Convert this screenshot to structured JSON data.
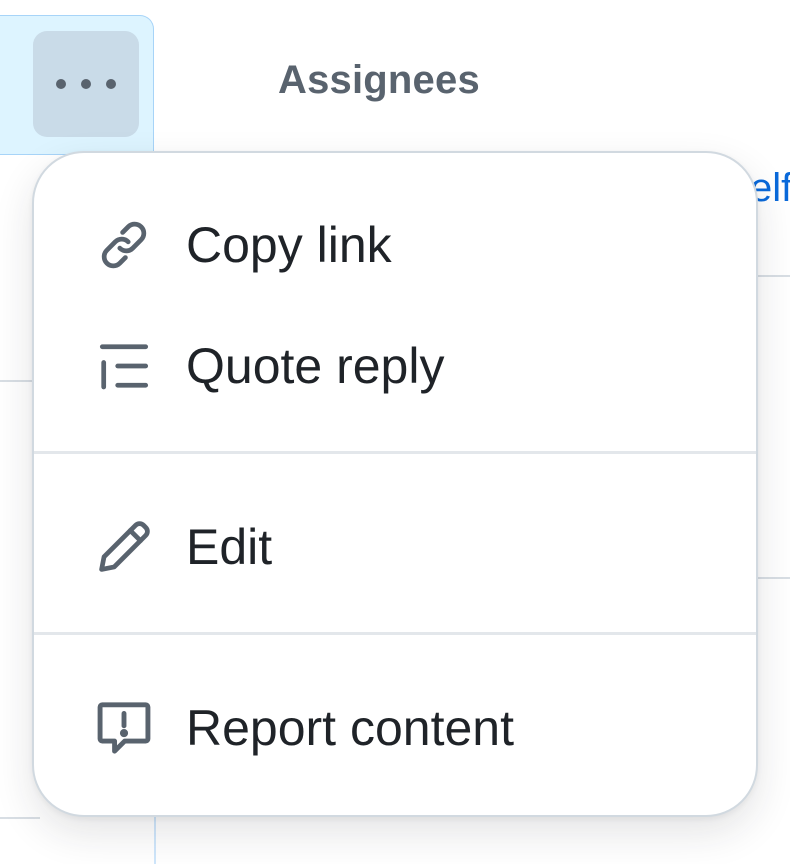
{
  "comment": {
    "more_button_label": "More options"
  },
  "sidebar": {
    "heading": "Assignees",
    "partial_link": "elf"
  },
  "menu": {
    "items": [
      {
        "label": "Copy link",
        "icon": "link-icon"
      },
      {
        "label": "Quote reply",
        "icon": "quote-icon"
      },
      {
        "label": "Edit",
        "icon": "pencil-icon"
      },
      {
        "label": "Report content",
        "icon": "report-icon"
      }
    ]
  },
  "colors": {
    "text": "#1f2328",
    "muted": "#59636e",
    "accent": "#0969da",
    "header_bg": "#ddf4ff",
    "border": "#d1d9e0"
  }
}
